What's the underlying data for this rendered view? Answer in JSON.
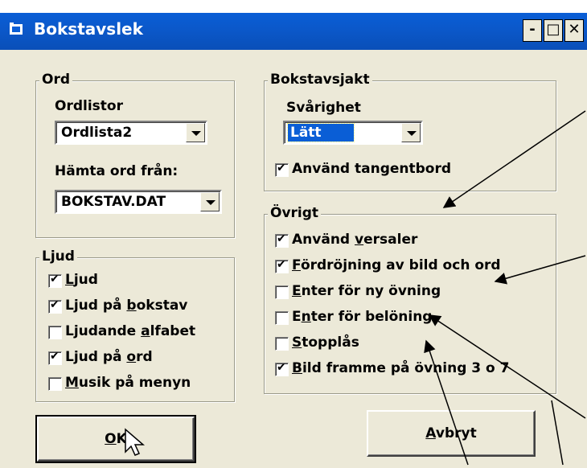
{
  "window": {
    "title": "Bokstavslek",
    "buttons": {
      "minimize": "-",
      "maximize": "□",
      "close": "✕"
    }
  },
  "ord": {
    "legend": "Ord",
    "ordlistor_label": "Ordlistor",
    "ordlistor_value": "Ordlista2",
    "hamta_label": "Hämta ord från:",
    "hamta_value": "BOKSTAV.DAT"
  },
  "ljud": {
    "legend": "Ljud",
    "items": [
      {
        "pre": "",
        "u": "L",
        "post": "jud",
        "checked": true
      },
      {
        "pre": "Ljud på ",
        "u": "b",
        "post": "okstav",
        "checked": true
      },
      {
        "pre": "Ljudande ",
        "u": "a",
        "post": "lfabet",
        "checked": false
      },
      {
        "pre": "Ljud på ",
        "u": "o",
        "post": "rd",
        "checked": true
      },
      {
        "pre": "",
        "u": "M",
        "post": "usik på menyn",
        "checked": false
      }
    ]
  },
  "jakt": {
    "legend": "Bokstavsjakt",
    "svarighet_label": "Svårighet",
    "svarighet_value": "Lätt",
    "tangent": {
      "label": "Använd tangentbord",
      "checked": true
    }
  },
  "ovrigt": {
    "legend": "Övrigt",
    "items": [
      {
        "pre": "Använd ",
        "u": "v",
        "post": "ersaler",
        "checked": true
      },
      {
        "pre": "",
        "u": "F",
        "post": "ördröjning av bild och ord",
        "checked": true
      },
      {
        "pre": "",
        "u": "E",
        "post": "nter för ny övning",
        "checked": false
      },
      {
        "pre": "E",
        "u": "n",
        "post": "ter för belöning",
        "checked": false
      },
      {
        "pre": "",
        "u": "S",
        "post": "topplås",
        "checked": false
      },
      {
        "pre": "",
        "u": "B",
        "post": "ild framme på övning 3 o 7",
        "checked": true
      }
    ]
  },
  "buttons": {
    "ok": {
      "u": "O",
      "post": "K"
    },
    "cancel": {
      "u": "A",
      "post": "vbryt"
    }
  }
}
